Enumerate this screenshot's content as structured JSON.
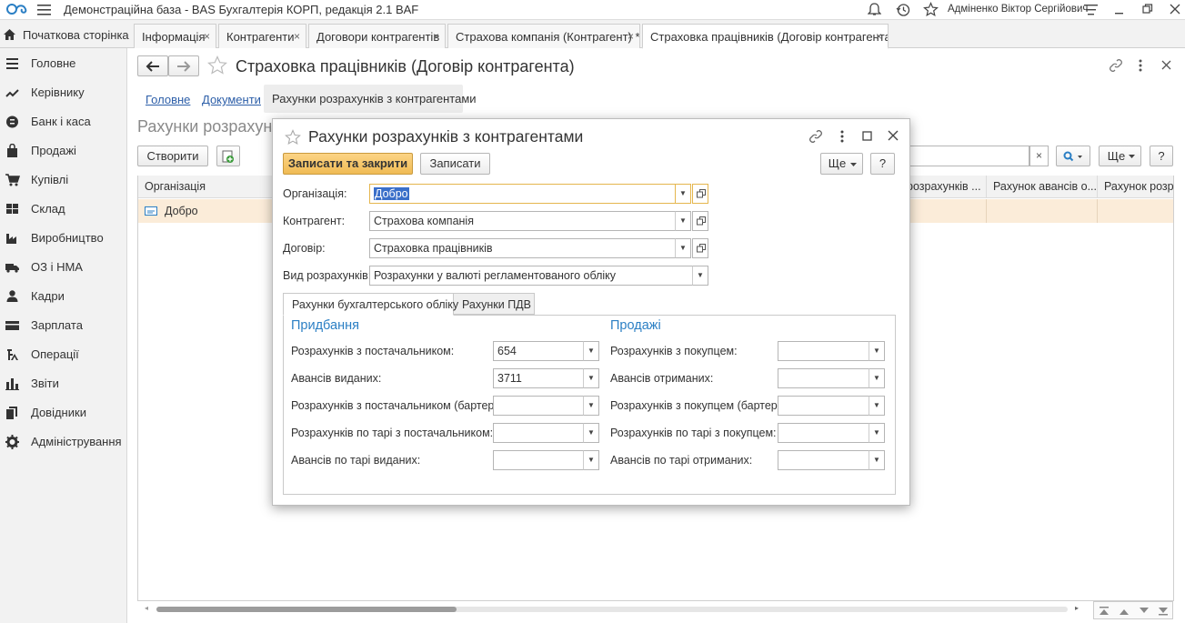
{
  "app": {
    "title": "Демонстраційна база - BAS Бухгалтерія КОРП, редакція 2.1 BAF",
    "user": "Адміненко Віктор Сергійович"
  },
  "tabs": [
    {
      "label": "Початкова сторінка"
    },
    {
      "label": "Інформація",
      "close": "×"
    },
    {
      "label": "Контрагенти",
      "close": "×"
    },
    {
      "label": "Договори контрагентів",
      "close": "×"
    },
    {
      "label": "Страхова компанія (Контрагент) *",
      "close": "×"
    },
    {
      "label": "Страховка працівників (Договір контрагента)",
      "close": "×"
    }
  ],
  "sidebar": {
    "items": [
      {
        "label": "Головне",
        "icon": "menu-icon"
      },
      {
        "label": "Керівнику",
        "icon": "trend-icon"
      },
      {
        "label": "Банк і каса",
        "icon": "coin-icon"
      },
      {
        "label": "Продажі",
        "icon": "bag-icon"
      },
      {
        "label": "Купівлі",
        "icon": "cart-icon"
      },
      {
        "label": "Склад",
        "icon": "warehouse-icon"
      },
      {
        "label": "Виробництво",
        "icon": "factory-icon"
      },
      {
        "label": "ОЗ і НМА",
        "icon": "truck-icon"
      },
      {
        "label": "Кадри",
        "icon": "person-icon"
      },
      {
        "label": "Зарплата",
        "icon": "card-icon"
      },
      {
        "label": "Операції",
        "icon": "operations-icon"
      },
      {
        "label": "Звіти",
        "icon": "chart-icon"
      },
      {
        "label": "Довідники",
        "icon": "books-icon"
      },
      {
        "label": "Адміністрування",
        "icon": "gear-icon"
      }
    ]
  },
  "main": {
    "title": "Страховка працівників (Договір контрагента)",
    "subnav": {
      "main": "Головне",
      "documents": "Документи",
      "accounts": "Рахунки розрахунків з контрагентами"
    },
    "list_title": "Рахунки розрахунків з контрагентами",
    "create_label": "Створити",
    "more_label": "Ще",
    "help_label": "?",
    "clear_label": "×",
    "columns": [
      "Організація",
      "розрахунків ...",
      "Рахунок авансів о...",
      "Рахунок розра"
    ],
    "row": {
      "org": "Добро"
    }
  },
  "dialog": {
    "title": "Рахунки розрахунків з контрагентами",
    "save_close_label": "Записати та закрити",
    "save_label": "Записати",
    "more_label": "Ще",
    "help_label": "?",
    "org_label": "Організація:",
    "org_value": "Добро",
    "contractor_label": "Контрагент:",
    "contractor_value": "Страхова компанія",
    "contract_label": "Договір:",
    "contract_value": "Страховка працівників",
    "calc_type_label": "Вид розрахунків:",
    "calc_type_value": "Розрахунки у валюті регламентованого обліку",
    "tab_accounting": "Рахунки бухгалтерського обліку",
    "tab_vat": "Рахунки ПДВ",
    "purchases_heading": "Придбання",
    "sales_heading": "Продажі",
    "purchases": [
      {
        "label": "Розрахунків з постачальником:",
        "value": "654"
      },
      {
        "label": "Авансів виданих:",
        "value": "3711"
      },
      {
        "label": "Розрахунків з постачальником (бартер):",
        "value": ""
      },
      {
        "label": "Розрахунків по тарі з постачальником:",
        "value": ""
      },
      {
        "label": "Авансів по тарі виданих:",
        "value": ""
      }
    ],
    "sales": [
      {
        "label": "Розрахунків з покупцем:",
        "value": ""
      },
      {
        "label": "Авансів отриманих:",
        "value": ""
      },
      {
        "label": "Розрахунків з покупцем (бартер):",
        "value": ""
      },
      {
        "label": "Розрахунків по тарі з покупцем:",
        "value": ""
      },
      {
        "label": "Авансів по тарі отриманих:",
        "value": ""
      }
    ]
  },
  "colors": {
    "accent": "#f5c76b",
    "link": "#2c5ea8",
    "heading": "#2b7fc4",
    "row_selected": "#fbecd9"
  }
}
